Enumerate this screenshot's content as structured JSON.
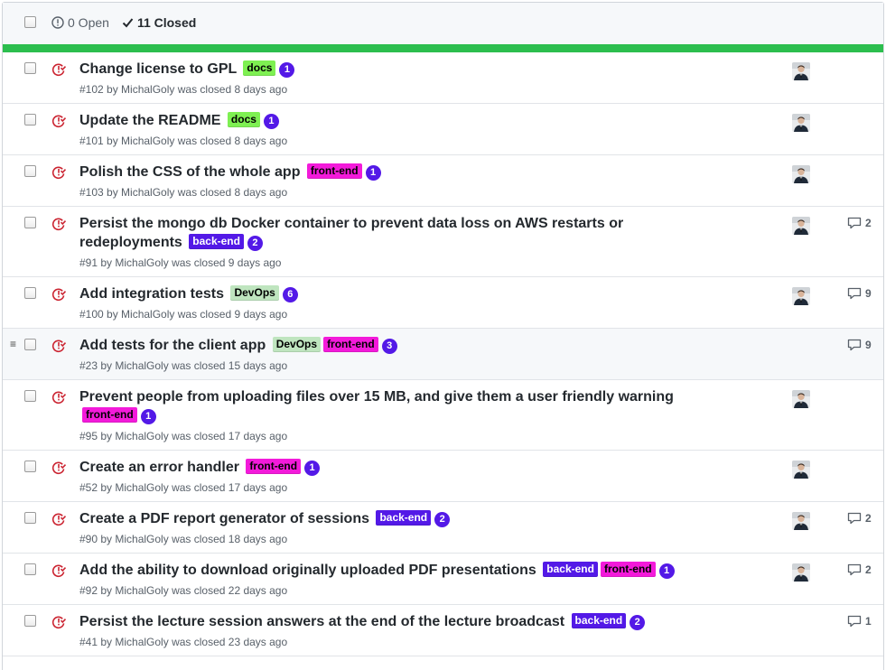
{
  "header": {
    "open_label": "0 Open",
    "closed_label": "11 Closed"
  },
  "label_colors": {
    "docs": "#7ef052",
    "front-end": "#f31ada",
    "back-end": "#5319e7",
    "DevOps": "#bfe5bf"
  },
  "issues": [
    {
      "title": "Change license to GPL",
      "labels": [
        "docs"
      ],
      "badge": "1",
      "number": "#102",
      "author": "MichalGoly",
      "meta_text": "was closed 8 days ago",
      "avatar": true,
      "comments": ""
    },
    {
      "title": "Update the README",
      "labels": [
        "docs"
      ],
      "badge": "1",
      "number": "#101",
      "author": "MichalGoly",
      "meta_text": "was closed 8 days ago",
      "avatar": true,
      "comments": ""
    },
    {
      "title": "Polish the CSS of the whole app",
      "labels": [
        "front-end"
      ],
      "badge": "1",
      "number": "#103",
      "author": "MichalGoly",
      "meta_text": "was closed 8 days ago",
      "avatar": true,
      "comments": ""
    },
    {
      "title": "Persist the mongo db Docker container to prevent data loss on AWS restarts or redeployments",
      "labels": [
        "back-end"
      ],
      "badge": "2",
      "number": "#91",
      "author": "MichalGoly",
      "meta_text": "was closed 9 days ago",
      "avatar": true,
      "comments": "2"
    },
    {
      "title": "Add integration tests",
      "labels": [
        "DevOps"
      ],
      "badge": "6",
      "number": "#100",
      "author": "MichalGoly",
      "meta_text": "was closed 9 days ago",
      "avatar": true,
      "comments": "9"
    },
    {
      "title": "Add tests for the client app",
      "labels": [
        "DevOps",
        "front-end"
      ],
      "badge": "3",
      "number": "#23",
      "author": "MichalGoly",
      "meta_text": "was closed 15 days ago",
      "avatar": false,
      "comments": "9",
      "hover": true
    },
    {
      "title": "Prevent people from uploading files over 15 MB, and give them a user friendly warning",
      "labels": [
        "front-end"
      ],
      "badge": "1",
      "number": "#95",
      "author": "MichalGoly",
      "meta_text": "was closed 17 days ago",
      "avatar": true,
      "comments": ""
    },
    {
      "title": "Create an error handler",
      "labels": [
        "front-end"
      ],
      "badge": "1",
      "number": "#52",
      "author": "MichalGoly",
      "meta_text": "was closed 17 days ago",
      "avatar": true,
      "comments": ""
    },
    {
      "title": "Create a PDF report generator of sessions",
      "labels": [
        "back-end"
      ],
      "badge": "2",
      "number": "#90",
      "author": "MichalGoly",
      "meta_text": "was closed 18 days ago",
      "avatar": true,
      "comments": "2"
    },
    {
      "title": "Add the ability to download originally uploaded PDF presentations",
      "labels": [
        "back-end",
        "front-end"
      ],
      "badge": "1",
      "number": "#92",
      "author": "MichalGoly",
      "meta_text": "was closed 22 days ago",
      "avatar": true,
      "comments": "2"
    },
    {
      "title": "Persist the lecture session answers at the end of the lecture broadcast",
      "labels": [
        "back-end"
      ],
      "badge": "2",
      "number": "#41",
      "author": "MichalGoly",
      "meta_text": "was closed 23 days ago",
      "avatar": false,
      "comments": "1"
    }
  ]
}
